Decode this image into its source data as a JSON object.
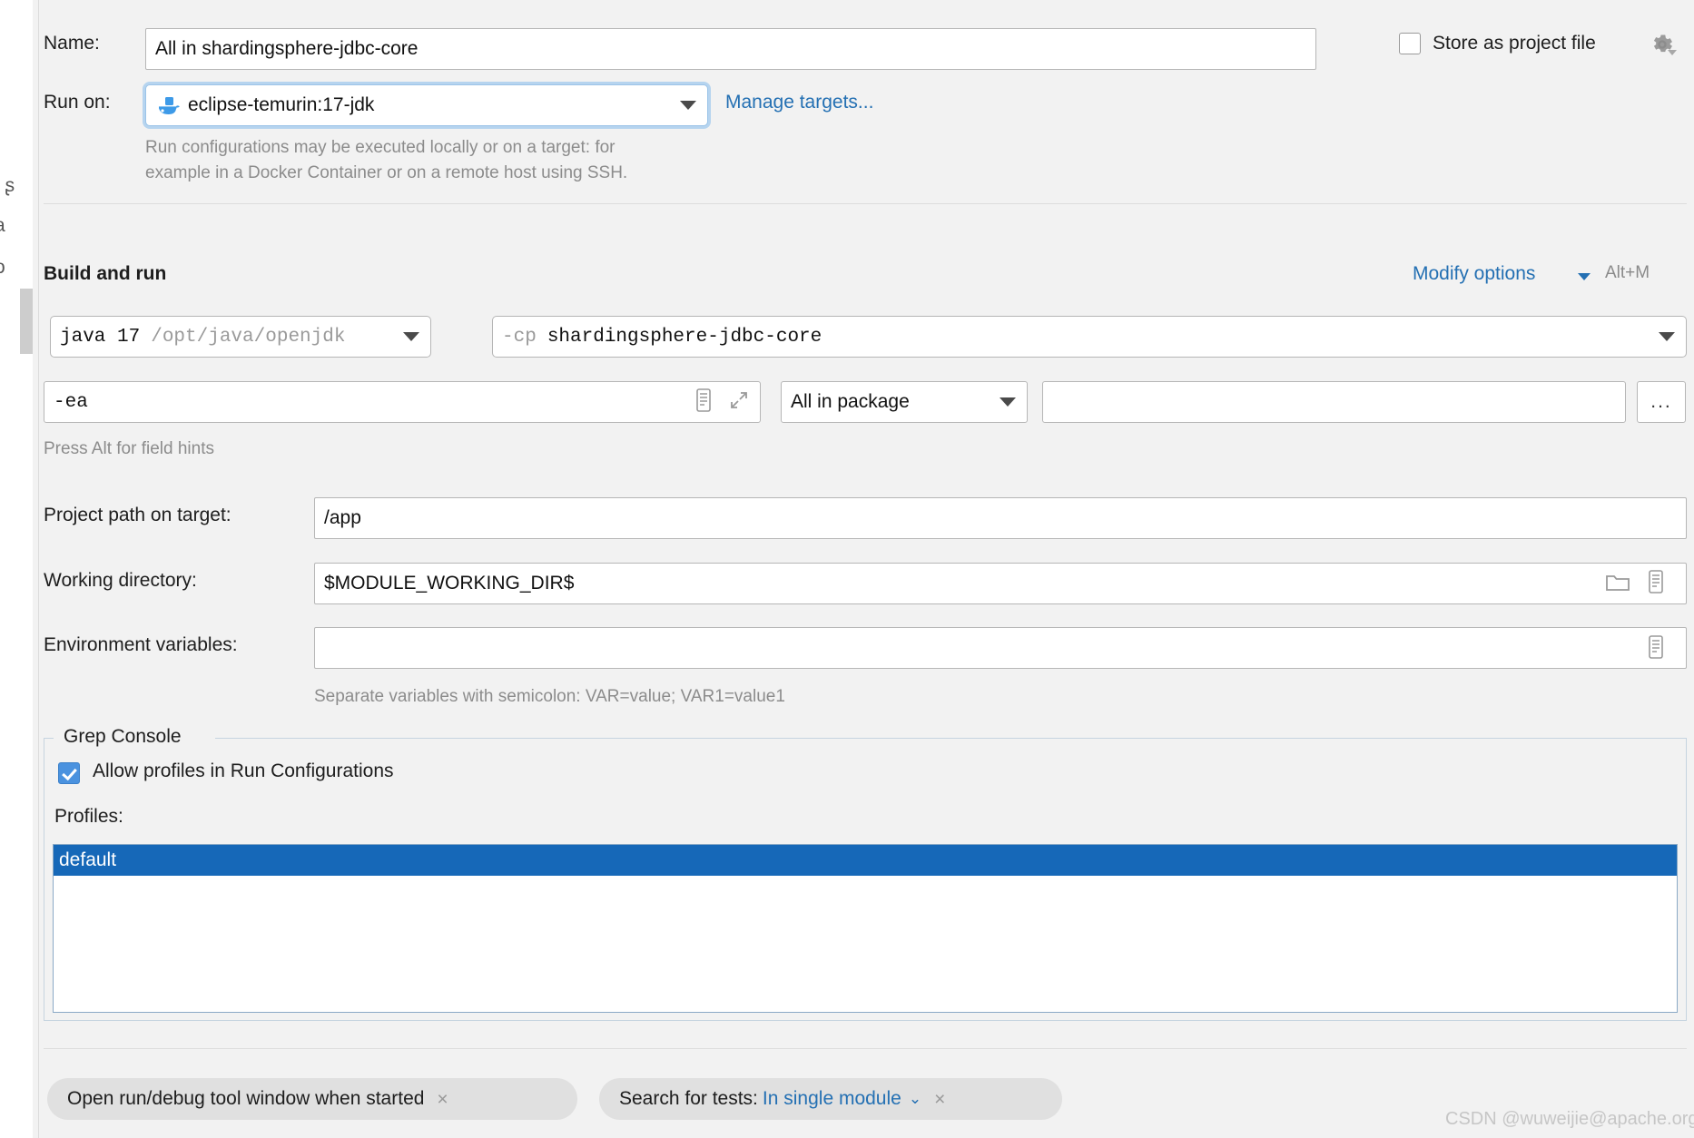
{
  "dialog": {
    "name_label": "Name:",
    "name_value": "All in shardingsphere-jdbc-core",
    "store_as_project_file_label": "Store as project file",
    "gear_icon": "gear-icon",
    "run_on_label": "Run on:",
    "run_on_value": "eclipse-temurin:17-jdk",
    "run_on_icon": "docker-whale-icon",
    "manage_targets_link": "Manage targets...",
    "run_on_description_line1": "Run configurations may be executed locally or on a target: for",
    "run_on_description_line2": "example in a Docker Container or on a remote host using SSH."
  },
  "build_and_run": {
    "section_title": "Build and run",
    "modify_options_link": "Modify options",
    "modify_options_shortcut": "Alt+M",
    "jre_value": "java 17",
    "jre_path": "/opt/java/openjdk",
    "classpath_prefix": "-cp",
    "classpath_value": "shardingsphere-jdbc-core",
    "vm_options_value": "-ea",
    "vm_expand_icon": "expand-editor-icon",
    "vm_insert_icon": "insert-macro-icon",
    "scope_value": "All in package",
    "package_value": "",
    "browse_button_label": "...",
    "field_hint": "Press Alt for field hints"
  },
  "target_settings": {
    "project_path_label": "Project path on target:",
    "project_path_value": "/app",
    "working_directory_label": "Working directory:",
    "working_directory_value": "$MODULE_WORKING_DIR$",
    "working_dir_folder_icon": "folder-icon",
    "working_dir_macro_icon": "insert-macro-icon",
    "environment_variables_label": "Environment variables:",
    "environment_variables_value": "",
    "environment_variables_icon": "insert-macro-icon",
    "environment_variables_hint": "Separate variables with semicolon: VAR=value; VAR1=value1"
  },
  "grep_console": {
    "group_title": "Grep Console",
    "allow_profiles_label": "Allow profiles in Run Configurations",
    "allow_profiles_checked": true,
    "profiles_label": "Profiles:",
    "profiles": [
      {
        "label": "default",
        "selected": true
      }
    ]
  },
  "bottom_chips": [
    {
      "label": "Open run/debug tool window when started",
      "close": "×"
    },
    {
      "label": "Search for tests:",
      "value": "In single module",
      "caret": "⌄",
      "close": "×"
    }
  ],
  "watermark": "CSDN @wuweijie@apache.org",
  "ghost_tree_fragments": [
    "ı ʂ",
    "a",
    "o"
  ],
  "colors": {
    "accent_blue": "#2470b3",
    "selection_blue": "#1668b8",
    "focus_ring": "#b6d4ef",
    "background": "#f2f2f2"
  }
}
